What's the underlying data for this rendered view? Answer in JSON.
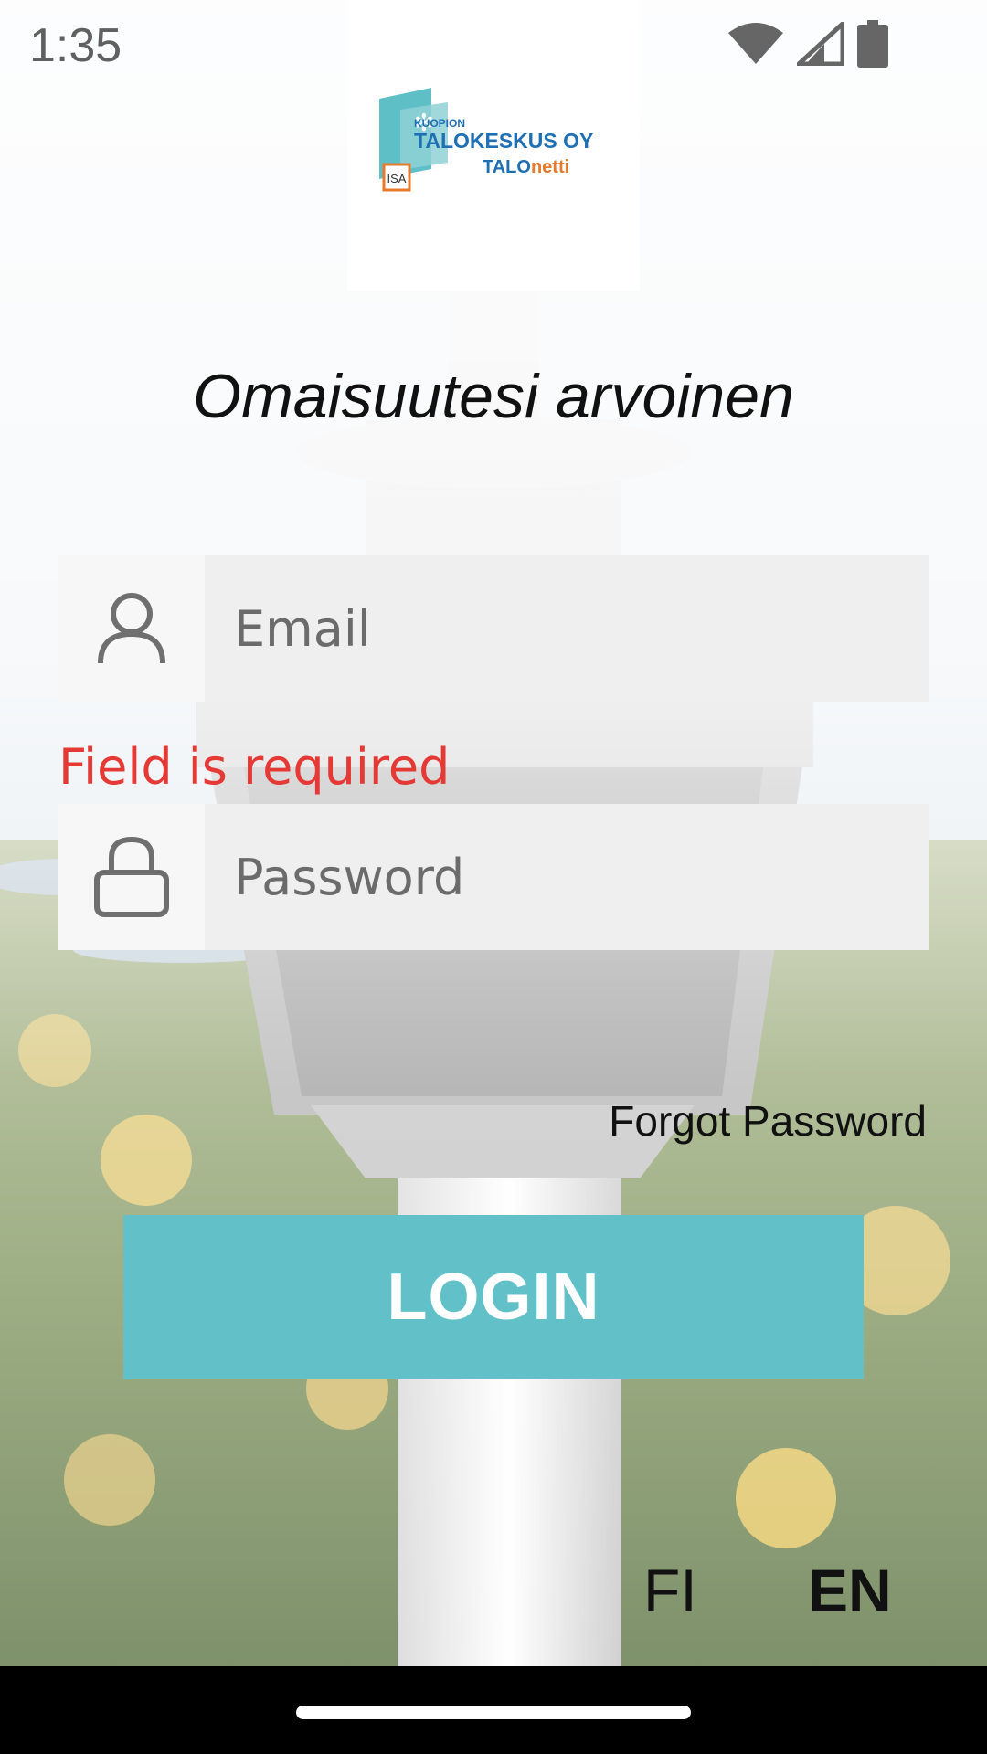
{
  "status_bar": {
    "time": "1:35",
    "icons": [
      "wifi-icon",
      "signal-icon",
      "battery-icon"
    ]
  },
  "logo": {
    "line1": "KUOPION",
    "line2": "TALOKESKUS OY",
    "line3_a": "TALO",
    "line3_b": "netti",
    "badge": "ISA"
  },
  "tagline": "Omaisuutesi arvoinen",
  "email": {
    "placeholder": "Email",
    "value": ""
  },
  "email_error": "Field is required",
  "password": {
    "placeholder": "Password",
    "value": ""
  },
  "forgot_password": "Forgot Password",
  "login_button": "LOGIN",
  "languages": {
    "fi": "FI",
    "en": "EN",
    "selected": "EN"
  },
  "colors": {
    "accent": "#62c0c8",
    "error": "#e53935",
    "logo_blue": "#1f6fb5",
    "logo_orange": "#e8792b"
  }
}
